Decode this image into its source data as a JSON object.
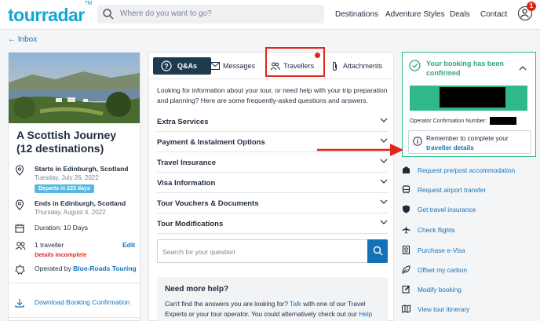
{
  "header": {
    "logo": "tourradar",
    "logo_tm": "TM",
    "search_placeholder": "Where do you want to go?",
    "nav": [
      "Destinations",
      "Adventure Styles",
      "Deals",
      "Contact"
    ],
    "notification_count": "1"
  },
  "back_link": "← Inbox",
  "trip": {
    "title": "A Scottish Journey (12 destinations)",
    "start_label": "Starts in Edinburgh, Scotland",
    "start_date": "Tuesday, July 26, 2022",
    "departs_badge": "Departs in 223 days",
    "end_label": "Ends in Edinburgh, Scotland",
    "end_date": "Thursday, August 4, 2022",
    "duration": "Duration: 10 Days",
    "travellers": "1 traveller",
    "edit": "Edit",
    "details_incomplete": "Details incomplete",
    "operated_prefix": "Operated by",
    "operator": "Blue-Roads Touring",
    "download": "Download Booking Confirmation"
  },
  "tabs": [
    {
      "label": "Q&As",
      "active": true
    },
    {
      "label": "Messages",
      "active": false
    },
    {
      "label": "Travellers",
      "active": false
    },
    {
      "label": "Attachments",
      "active": false
    }
  ],
  "qa": {
    "intro": "Looking for information about your tour, or need help with your trip preparation and planning? Here are some frequently-asked questions and answers.",
    "sections": [
      "Extra Services",
      "Payment & Instalment Options",
      "Travel Insurance",
      "Visa Information",
      "Tour Vouchers & Documents",
      "Tour Modifications"
    ],
    "search_placeholder": "Search for your question",
    "help_title": "Need more help?",
    "help_body_1": "Can't find the answers you are looking for?",
    "help_link_1": "Talk",
    "help_body_2": "with one of our Travel Experts or your tour operator. You could alternatively check out our",
    "help_link_2": "Help"
  },
  "booking": {
    "title": "Your booking has been confirmed",
    "operator_conf_label": "Operator Confirmation Number:",
    "reminder_text": "Remember to complete your",
    "reminder_link": "traveller details"
  },
  "actions": [
    {
      "icon": "store-icon",
      "label": "Request pre/post accommodation"
    },
    {
      "icon": "bus-icon",
      "label": "Request airport transfer"
    },
    {
      "icon": "shield-icon",
      "label": "Get travel insurance"
    },
    {
      "icon": "plane-icon",
      "label": "Check flights"
    },
    {
      "icon": "passport-icon",
      "label": "Purchase e-Visa"
    },
    {
      "icon": "leaf-icon",
      "label": "Offset my carbon"
    },
    {
      "icon": "edit-icon",
      "label": "Modify booking"
    },
    {
      "icon": "map-icon",
      "label": "View tour itinerary"
    }
  ],
  "colors": {
    "brand": "#13a7d3",
    "accent": "#1572b8",
    "confirm": "#2fb98a",
    "alert": "#e0251b",
    "dark": "#1d3a4f"
  }
}
